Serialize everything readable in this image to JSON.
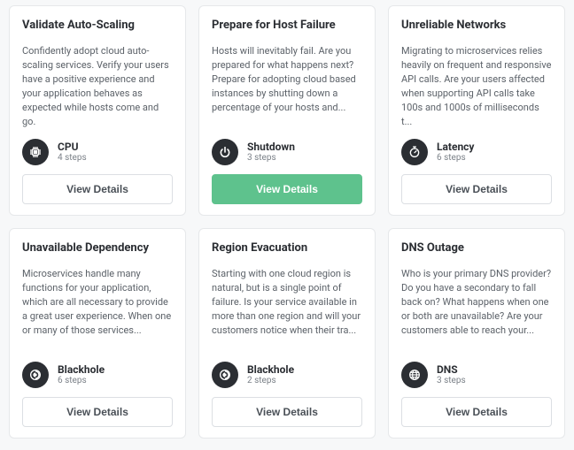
{
  "button_label": "View Details",
  "cards": [
    {
      "title": "Validate Auto-Scaling",
      "desc": "Confidently adopt cloud auto-scaling services. Verify your users have a positive experience and your application behaves as expected while hosts come and go.",
      "attack": {
        "name": "CPU",
        "steps": "4 steps",
        "icon": "cpu-icon"
      },
      "active": false
    },
    {
      "title": "Prepare for Host Failure",
      "desc": "Hosts will inevitably fail. Are you prepared for what happens next? Prepare for adopting cloud based instances by shutting down a percentage of your hosts and...",
      "attack": {
        "name": "Shutdown",
        "steps": "3 steps",
        "icon": "power-icon"
      },
      "active": true
    },
    {
      "title": "Unreliable Networks",
      "desc": "Migrating to microservices relies heavily on frequent and responsive API calls. Are your users affected when supporting API calls take 100s and 1000s of milliseconds t...",
      "attack": {
        "name": "Latency",
        "steps": "6 steps",
        "icon": "latency-icon"
      },
      "active": false
    },
    {
      "title": "Unavailable Dependency",
      "desc": "Microservices handle many functions for your application, which are all necessary to provide a great user experience. When one or many of those services...",
      "attack": {
        "name": "Blackhole",
        "steps": "6 steps",
        "icon": "blackhole-icon"
      },
      "active": false
    },
    {
      "title": "Region Evacuation",
      "desc": "Starting with one cloud region is natural, but is a single point of failure. Is your service available in more than one region and will your customers notice when their tra...",
      "attack": {
        "name": "Blackhole",
        "steps": "2 steps",
        "icon": "blackhole-icon"
      },
      "active": false
    },
    {
      "title": "DNS Outage",
      "desc": "Who is your primary DNS provider? Do you have a secondary to fall back on? What happens when one or both are unavailable? Are your customers able to reach your...",
      "attack": {
        "name": "DNS",
        "steps": "3 steps",
        "icon": "globe-icon"
      },
      "active": false
    }
  ]
}
